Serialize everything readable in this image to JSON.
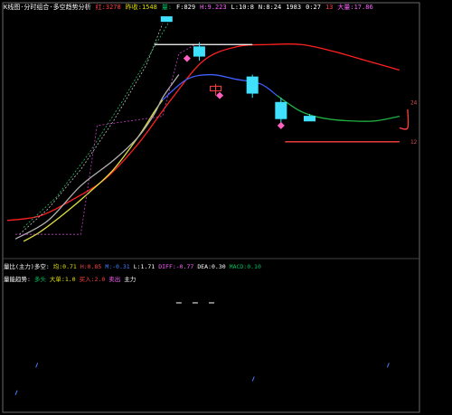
{
  "header": {
    "items": [
      {
        "text": "K线图·分时组合·多空趋势分析",
        "color": "#ffffff"
      },
      {
        "text": "红:3278",
        "color": "#ff4040"
      },
      {
        "text": "昨收:1548",
        "color": "#e0e000"
      },
      {
        "text": "量:",
        "color": "#00c060"
      },
      {
        "text": "F:829",
        "color": "#ffffff"
      },
      {
        "text": "H:9.223",
        "color": "#ff60ff"
      },
      {
        "text": "L:10:8",
        "color": "#ffffff"
      },
      {
        "text": "N:8:24",
        "color": "#ffffff"
      },
      {
        "text": "1983",
        "color": "#ffffff"
      },
      {
        "text": "0:27",
        "color": "#ffffff"
      },
      {
        "text": "13",
        "color": "#ff4040"
      },
      {
        "text": "大量:17.86",
        "color": "#ff60ff"
      }
    ]
  },
  "indicator_row_1": {
    "items": [
      {
        "text": "量比(主力)多空:",
        "color": "#ffffff"
      },
      {
        "text": "均:0.71",
        "color": "#e0e000"
      },
      {
        "text": "H:0.85",
        "color": "#ff4040"
      },
      {
        "text": "M:-0.31",
        "color": "#4080ff"
      },
      {
        "text": "L:1.71",
        "color": "#ffffff"
      },
      {
        "text": "DIFF:-0.77",
        "color": "#ff60ff"
      },
      {
        "text": "DEA:0.30",
        "color": "#ffffff"
      },
      {
        "text": "MACD:0.10",
        "color": "#00c060"
      }
    ]
  },
  "indicator_row_2": {
    "items": [
      {
        "text": "量能趋势:",
        "color": "#ffffff"
      },
      {
        "text": "多头",
        "color": "#00c060"
      },
      {
        "text": "大单:1.0",
        "color": "#e0e000"
      },
      {
        "text": "买入:2.0",
        "color": "#ff4040"
      },
      {
        "text": "卖出",
        "color": "#ff60ff"
      },
      {
        "text": "主力",
        "color": "#ffffff"
      }
    ]
  },
  "chart_data": {
    "type": "line",
    "x_range": [
      0,
      100
    ],
    "y_range": [
      0,
      100
    ],
    "right_ticks": [
      {
        "label": "24",
        "y": 62
      },
      {
        "label": "12",
        "y": 45
      }
    ],
    "series": [
      {
        "color": "#ff2020",
        "style": "solid",
        "points": [
          [
            0,
            11
          ],
          [
            8,
            13
          ],
          [
            16,
            20
          ],
          [
            24,
            29
          ],
          [
            32,
            44
          ],
          [
            40,
            63
          ],
          [
            48,
            80
          ],
          [
            56,
            86
          ],
          [
            64,
            87
          ],
          [
            72,
            87
          ],
          [
            80,
            84
          ],
          [
            88,
            80
          ],
          [
            96,
            76
          ]
        ]
      },
      {
        "color": "#e0e040",
        "style": "solid",
        "points": [
          [
            4,
            2
          ],
          [
            8,
            6
          ],
          [
            14,
            14
          ],
          [
            20,
            23
          ],
          [
            26,
            33
          ],
          [
            32,
            47
          ],
          [
            36,
            58
          ],
          [
            38,
            63
          ]
        ]
      },
      {
        "color": "#4060ff",
        "style": "solid",
        "points": [
          [
            38,
            63
          ],
          [
            44,
            72
          ],
          [
            50,
            74
          ],
          [
            56,
            72
          ],
          [
            62,
            70
          ],
          [
            66,
            65
          ]
        ]
      },
      {
        "color": "#20b040",
        "style": "solid",
        "points": [
          [
            66,
            65
          ],
          [
            72,
            58
          ],
          [
            78,
            55
          ],
          [
            84,
            54
          ],
          [
            90,
            54
          ],
          [
            96,
            56
          ]
        ]
      },
      {
        "color": "#b0b0b0",
        "style": "solid",
        "points": [
          [
            2,
            3
          ],
          [
            10,
            11
          ],
          [
            18,
            26
          ],
          [
            26,
            37
          ],
          [
            32,
            47
          ],
          [
            36,
            57
          ],
          [
            38,
            64
          ],
          [
            42,
            74
          ]
        ]
      },
      {
        "color": "#c0c0c0",
        "style": "dashed",
        "points": [
          [
            3,
            5
          ],
          [
            10,
            16
          ],
          [
            18,
            33
          ],
          [
            26,
            54
          ],
          [
            34,
            78
          ],
          [
            38,
            96
          ]
        ]
      },
      {
        "color": "#20c060",
        "style": "dashed",
        "points": [
          [
            4,
            8
          ],
          [
            12,
            21
          ],
          [
            20,
            40
          ],
          [
            28,
            62
          ],
          [
            36,
            86
          ],
          [
            40,
            98
          ]
        ]
      },
      {
        "color": "#c040c0",
        "style": "dashed",
        "points": [
          [
            2,
            5
          ],
          [
            18,
            5
          ],
          [
            22,
            52
          ],
          [
            30,
            54
          ],
          [
            38,
            56
          ],
          [
            42,
            83
          ],
          [
            46,
            87
          ]
        ]
      },
      {
        "color": "#ffffff",
        "style": "solid",
        "points": [
          [
            36,
            87
          ],
          [
            60,
            87
          ]
        ]
      },
      {
        "color": "#ff4040",
        "style": "solid",
        "points": [
          [
            68,
            45
          ],
          [
            96,
            45
          ]
        ]
      },
      {
        "color": "#ff4040",
        "style": "solid",
        "points": [
          [
            96,
            51
          ],
          [
            98,
            51
          ],
          [
            98,
            59
          ]
        ]
      }
    ],
    "candles": [
      {
        "x": 39,
        "open": 99,
        "close": 97,
        "high": 99,
        "low": 97,
        "color": "#40e0ff"
      },
      {
        "x": 47,
        "open": 86,
        "close": 82,
        "high": 88,
        "low": 80,
        "color": "#40e0ff"
      },
      {
        "x": 51,
        "open": 69,
        "close": 67,
        "high": 70,
        "low": 65,
        "color": "#ff4040"
      },
      {
        "x": 60,
        "open": 73,
        "close": 66,
        "high": 74,
        "low": 64,
        "color": "#40e0ff"
      },
      {
        "x": 67,
        "open": 62,
        "close": 55,
        "high": 64,
        "low": 53,
        "color": "#40e0ff"
      },
      {
        "x": 74,
        "open": 56,
        "close": 54,
        "high": 57,
        "low": 54,
        "color": "#40e0ff"
      }
    ],
    "markers": [
      {
        "x": 44,
        "y": 81,
        "color": "#ff60c0"
      },
      {
        "x": 52,
        "y": 65,
        "color": "#ff60c0"
      },
      {
        "x": 67,
        "y": 52,
        "color": "#ff60c0"
      }
    ],
    "lower_dashes": [
      [
        42,
        77
      ],
      [
        46,
        77
      ],
      [
        50,
        77
      ]
    ],
    "lower_spikes": [
      [
        2,
        10
      ],
      [
        7,
        30
      ],
      [
        60,
        20
      ],
      [
        93,
        30
      ]
    ]
  }
}
